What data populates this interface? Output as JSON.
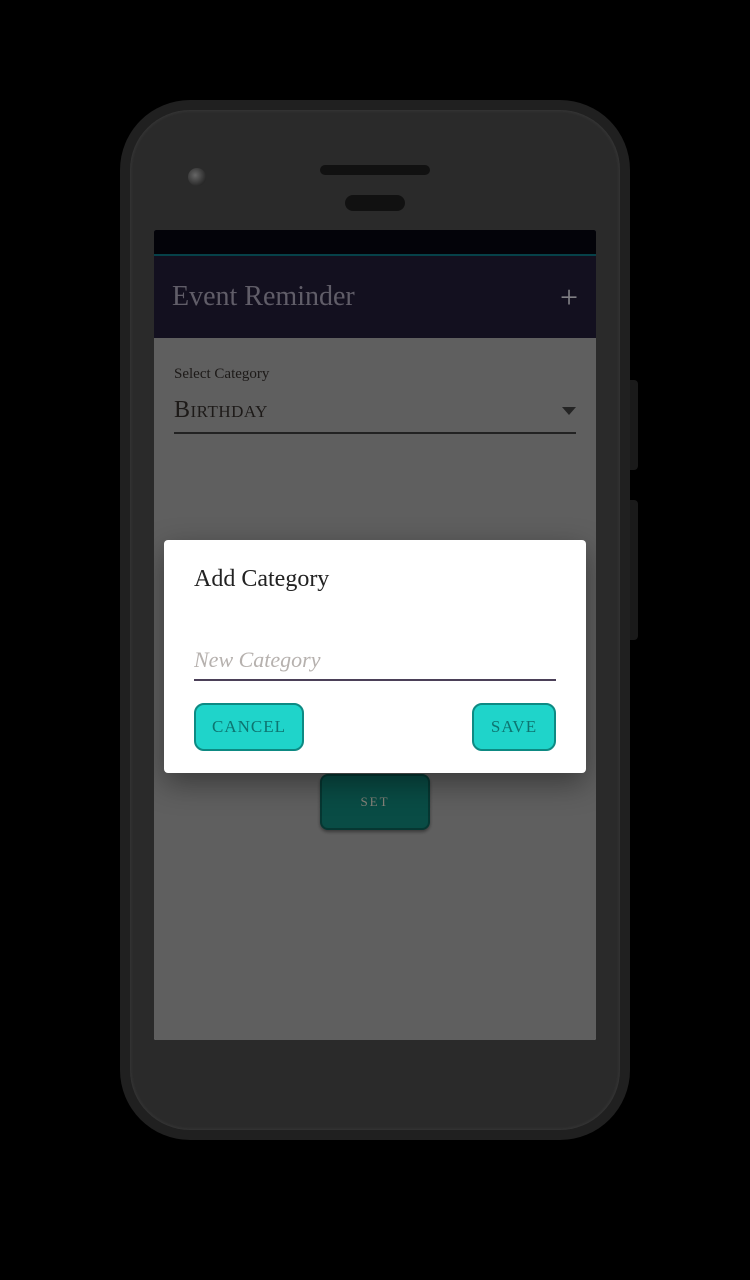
{
  "app": {
    "title": "Event Reminder",
    "add_icon_label": "+"
  },
  "form": {
    "category_label": "Select Category",
    "category_value": "Birthday",
    "set_button": "SET"
  },
  "dialog": {
    "title": "Add Category",
    "input_placeholder": "New Category",
    "input_value": "",
    "cancel": "CANCEL",
    "save": "SAVE"
  }
}
